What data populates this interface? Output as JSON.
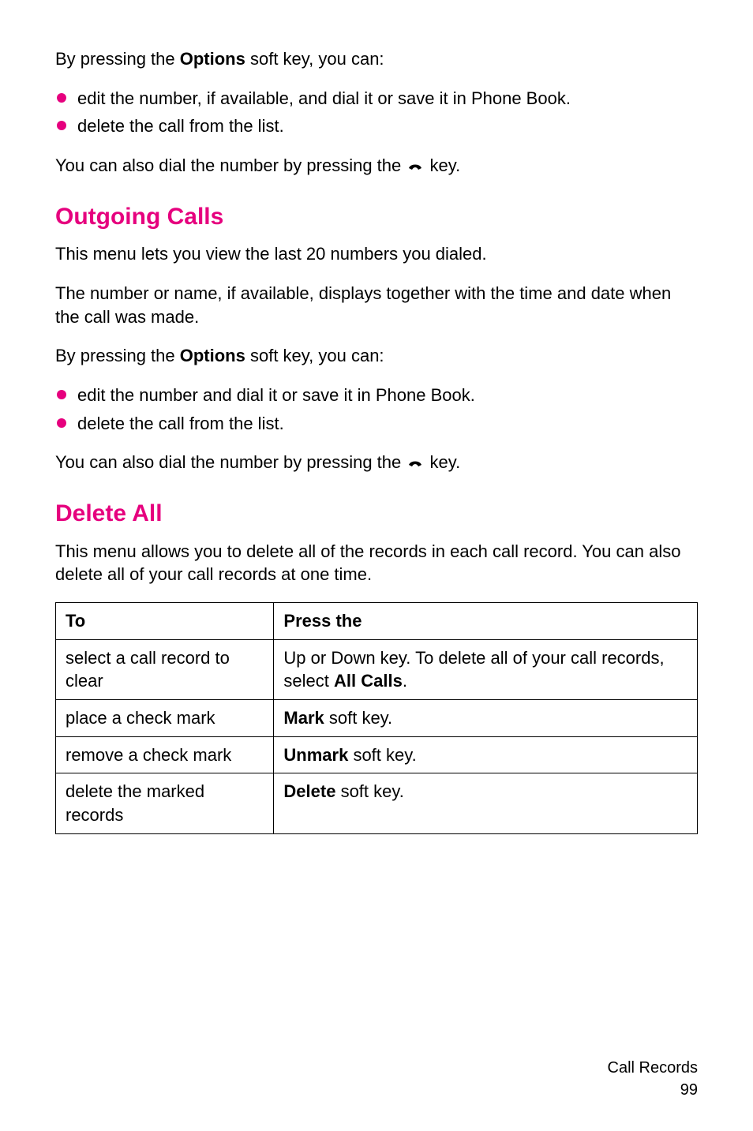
{
  "intro": {
    "by_pressing_pre": "By pressing the ",
    "options_label": "Options",
    "by_pressing_post": " soft key, you can:",
    "bullets": [
      "edit the number, if available, and dial it or save it in Phone Book.",
      "delete the call from the list."
    ],
    "dial_pre": "You can also dial the number by pressing the ",
    "dial_post": " key."
  },
  "outgoing": {
    "heading": "Outgoing Calls",
    "desc1": "This menu lets you view the last 20 numbers you dialed.",
    "desc2": "The number or name, if available, displays together with the time and date when the call was made.",
    "by_pressing_pre": "By pressing the ",
    "options_label": "Options",
    "by_pressing_post": " soft key, you can:",
    "bullets": [
      "edit the number and dial it or save it in Phone Book.",
      "delete the call from the list."
    ],
    "dial_pre": "You can also dial the number by pressing the ",
    "dial_post": "  key."
  },
  "deleteall": {
    "heading": "Delete All",
    "desc": "This menu allows you to delete all of the records in each call record. You can also delete all of your call records at one time.",
    "table": {
      "headers": [
        "To",
        "Press the"
      ],
      "rows": [
        {
          "to": "select a call record to clear",
          "press_pre": "Up or Down key. To delete all of your call records, select ",
          "press_bold": "All Calls",
          "press_post": "."
        },
        {
          "to": "place a check mark",
          "press_bold": "Mark",
          "press_post": " soft key."
        },
        {
          "to": "remove a check mark",
          "press_bold": "Unmark",
          "press_post": " soft key."
        },
        {
          "to": "delete the marked records",
          "press_bold": "Delete",
          "press_post": " soft key."
        }
      ]
    }
  },
  "footer": {
    "section": "Call Records",
    "page": "99"
  }
}
